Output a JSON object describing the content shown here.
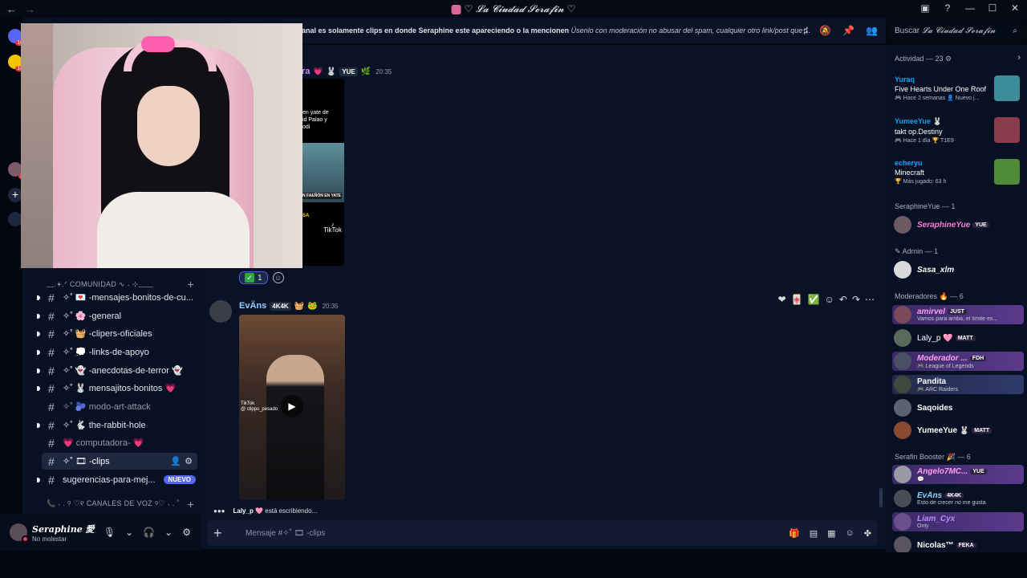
{
  "titlebar": {
    "title": "♡ 𝓛𝓪 𝓒𝓲𝓾𝓭𝓪𝓭 𝓢𝓮𝓻𝓪𝓯𝓲𝓷 ♡",
    "back": "←",
    "forward": "→"
  },
  "header": {
    "topic_bold": "anal es solamente clips en donde Seraphine este apareciendo o la mencionen",
    "topic_italic": "Úsenlo con moderación no abusar del spam, cualquier otro link/post que ...",
    "search_label": "Buscar",
    "search_server": "𝓛𝓪 𝓒𝓲𝓾𝓭𝓪𝓭 𝓢𝓮𝓻𝓪𝓯𝓲𝓷"
  },
  "rail": {
    "badges": [
      "16",
      "18",
      "2"
    ]
  },
  "sidebar": {
    "category_community": "﹏.𖥔.ᐟ COMUNIDAD ∿ ˖ ⊹﹏﹏",
    "category_voice": "📞 ˖ . ୨ ♡୧ CANALES DE VOZ ୨♡ ˖ . ˚",
    "channels": [
      {
        "label": "✧˚ 💌 -mensajes-bonitos-de-cu..."
      },
      {
        "label": "✧˚ 🌸 -general"
      },
      {
        "label": "✧˚ 🧺 -clipers-oficiales"
      },
      {
        "label": "✧˚ 💭 -links-de-apoyo"
      },
      {
        "label": "✧˚ 👻 -anecdotas-de-terror 👻"
      },
      {
        "label": "✧˚ 🐰 mensajitos-bonitos 💗"
      },
      {
        "label": "✧˚ 🫐 modo-art-attack"
      },
      {
        "label": "✧˚ 🐇 the-rabbit-hole"
      },
      {
        "label": "💗 computadora- 💗"
      },
      {
        "label": "✧˚ 🎞 -clips"
      },
      {
        "label": "sugerencias-para-mej..."
      }
    ],
    "new_badge": "NUEVO"
  },
  "user": {
    "name": "Seraphine 愛",
    "status": "No molestar"
  },
  "chat": {
    "msg1": {
      "name_partial": "ra",
      "tag": "YUE",
      "time": "20:35"
    },
    "media1": {
      "text": "en yate de\nid Palao y\nodi",
      "banner": "N FAEÑÓN EN YATE",
      "sa": "SA",
      "tiktok": "TikTok"
    },
    "reaction": {
      "count": "1"
    },
    "msg2": {
      "name": "EvÄns",
      "tag": "4K4K",
      "time": "20:35"
    },
    "video": {
      "watermark": "TikTok\n@ clipps_pesado"
    },
    "typing": {
      "user": "Laly_p 🩷",
      "text": "está escribiendo..."
    }
  },
  "composer": {
    "placeholder": "Mensaje #✧˚ 🎞 -clips"
  },
  "members": {
    "activity_title": "Actividad — 23",
    "activities": [
      {
        "user": "Yuraq",
        "game": "Five Hearts Under One Roof",
        "meta": "🎮 Hace 2 semanas  👤 Nuevo j...",
        "color": "#3c8c9a"
      },
      {
        "user": "YumeeYue 🐰",
        "game": "takt op.Destiny",
        "meta": "🎮 Hace 1 día  🏆 T1E9",
        "color": "#8a3b4c"
      },
      {
        "user": "echeryu",
        "game": "Minecraft",
        "meta": "🏆 Más jugado: 63 h",
        "color": "#4f8a38"
      }
    ],
    "groups": {
      "seraphine": "SeraphineYue — 1",
      "admin": "Admin — 1",
      "mods": "Moderadores 🔥 — 6",
      "booster": "Serafin Booster 🎉 — 6"
    },
    "list": [
      {
        "name": "SeraphineYue",
        "badge": "YUE",
        "sub": "",
        "color": "#ff7ad9"
      },
      {
        "name": "Sasa_xlm",
        "badge": "",
        "sub": "",
        "color": "#ffffff"
      },
      {
        "name": "amirvel",
        "badge": "JUST",
        "sub": "Vamos para arriba, el límite es...",
        "color": "#ff9ef0"
      },
      {
        "name": "Laly_p 🩷",
        "badge": "MATT",
        "sub": "",
        "color": "#ffffff"
      },
      {
        "name": "Moderador ...",
        "badge": "FDH",
        "sub": "🎮 League of Legends",
        "color": "#ff9ef0"
      },
      {
        "name": "Pandita",
        "badge": "",
        "sub": "🎮 ARC Raiders",
        "color": "#ffffff"
      },
      {
        "name": "Saqoides",
        "badge": "",
        "sub": "",
        "color": "#ffffff"
      },
      {
        "name": "YumeeYue 🐰",
        "badge": "MATT",
        "sub": "",
        "color": "#ffffff"
      },
      {
        "name": "Angelo7MC...",
        "badge": "YUE",
        "sub": "💬",
        "color": "#ff9ef0"
      },
      {
        "name": "EvÄns",
        "badge": "4K4K",
        "sub": "Esto de crecer no me gusta",
        "color": "#8fd3ff"
      },
      {
        "name": "Liam_Cyx",
        "badge": "",
        "sub": "Only",
        "color": "#b98cff"
      },
      {
        "name": "Nicolas™",
        "badge": "FEKA",
        "sub": "",
        "color": "#ffffff"
      }
    ]
  }
}
